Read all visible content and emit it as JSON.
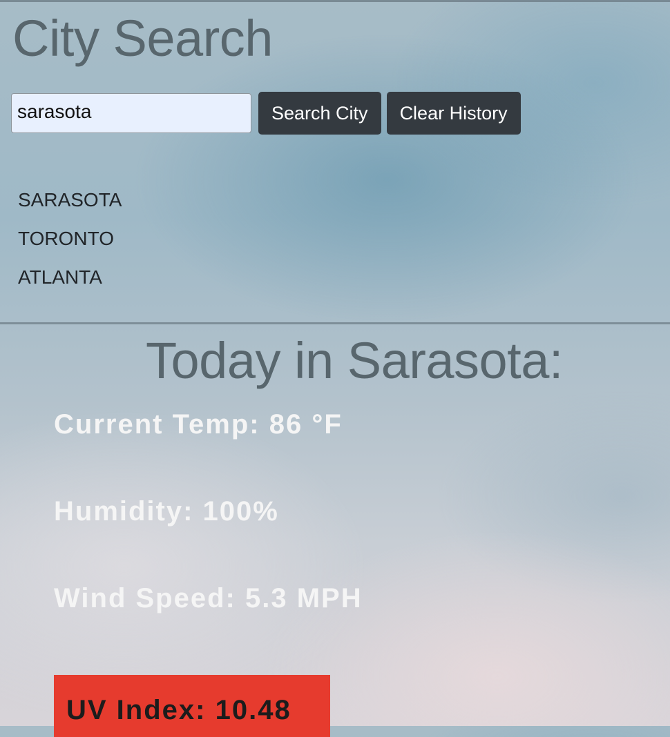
{
  "search": {
    "title": "City Search",
    "input_value": "sarasota",
    "search_button_label": "Search City",
    "clear_button_label": "Clear History"
  },
  "history": {
    "items": [
      "SARASOTA",
      "TORONTO",
      "ATLANTA"
    ]
  },
  "today": {
    "title": "Today in Sarasota:",
    "temp": "Current Temp: 86 °F",
    "humidity": "Humidity: 100%",
    "wind": "Wind Speed: 5.3 MPH",
    "uv": "UV Index: 10.48",
    "uv_color": "#e63b2e"
  }
}
